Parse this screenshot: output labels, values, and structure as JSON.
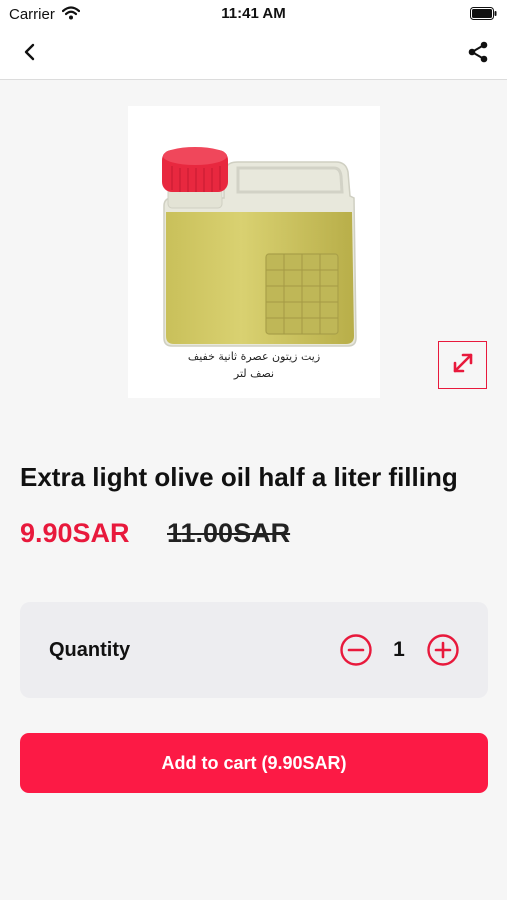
{
  "status_bar": {
    "carrier": "Carrier",
    "time": "11:41 AM"
  },
  "nav": {
    "back_icon": "chevron-left-icon",
    "share_icon": "share-icon"
  },
  "product": {
    "image_caption_line1": "زيت زيتون عصرة ثانية خفيف",
    "image_caption_line2": "نصف لتر",
    "title": "Extra light olive oil half a liter filling",
    "price": "9.90SAR",
    "old_price": "11.00SAR",
    "expand_icon": "expand-arrows-icon"
  },
  "quantity": {
    "label": "Quantity",
    "value": "1",
    "minus_icon": "minus-circle-icon",
    "plus_icon": "plus-circle-icon"
  },
  "cart": {
    "button_label": "Add to cart (9.90SAR)"
  },
  "colors": {
    "accent": "#e8193c",
    "button": "#fc1a45",
    "background": "#f6f6f6",
    "card": "#ededf0"
  }
}
